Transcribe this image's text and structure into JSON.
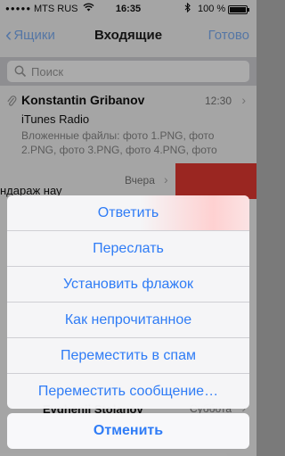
{
  "status_bar": {
    "signal": "●●●●●",
    "carrier": "MTS RUS",
    "time": "16:35",
    "battery_pct": "100 %",
    "battery_level": 1.0
  },
  "nav": {
    "back_label": "Ящики",
    "title": "Входящие",
    "done_label": "Готово"
  },
  "search": {
    "placeholder": "Поиск"
  },
  "messages": [
    {
      "sender": "Konstantin Gribanov",
      "time": "12:30",
      "subject": "iTunes Radio",
      "preview": "Вложенные файлы: фото 1.PNG, фото 2.PNG, фото 3.PNG, фото 4.PNG, фото"
    },
    {
      "text_cut": "ндараж нау",
      "date": "Вчера"
    },
    {
      "sender": "Evghenii Stolanov",
      "date": "Суббота"
    }
  ],
  "action_sheet": {
    "items": [
      "Ответить",
      "Переслать",
      "Установить флажок",
      "Как непрочитанное",
      "Переместить в спам",
      "Переместить сообщение…"
    ],
    "cancel_label": "Отменить"
  },
  "colors": {
    "accent": "#2f7cf6",
    "delete": "#e63a32"
  }
}
